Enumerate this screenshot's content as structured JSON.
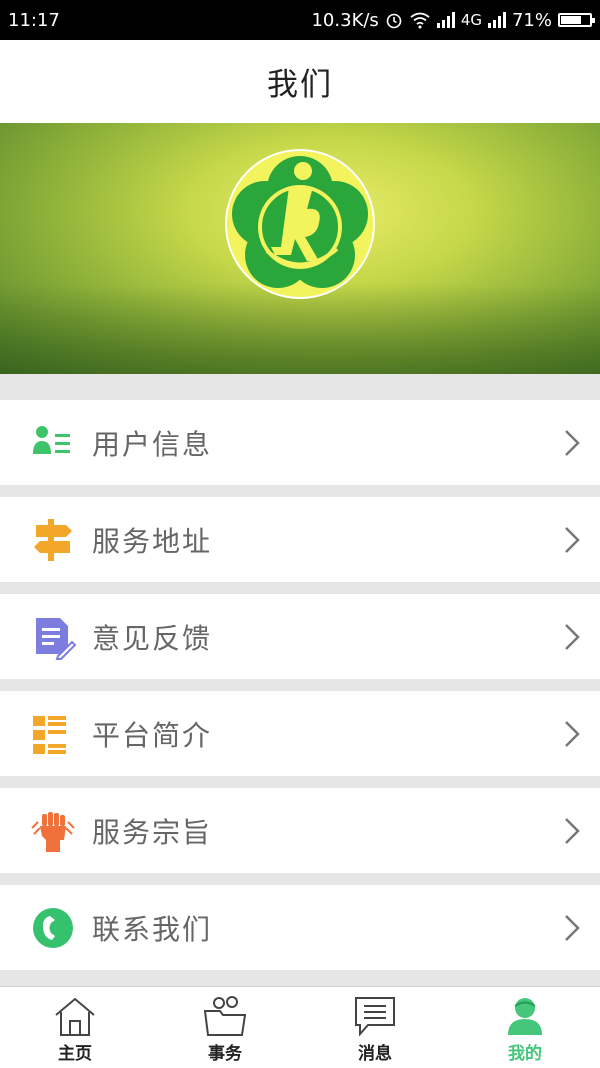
{
  "status_bar": {
    "time": "11:17",
    "network_speed": "10.3K/s",
    "network_type": "4G",
    "battery_percent": "71%",
    "battery_level": 0.71
  },
  "header": {
    "title": "我们"
  },
  "menu": [
    {
      "label": "用户信息",
      "icon": "user-info-icon",
      "color": "#3ec36a"
    },
    {
      "label": "服务地址",
      "icon": "signpost-icon",
      "color": "#f2a62a"
    },
    {
      "label": "意见反馈",
      "icon": "feedback-edit-icon",
      "color": "#7d7ddf"
    },
    {
      "label": "平台简介",
      "icon": "grid-list-icon",
      "color": "#f2a62a"
    },
    {
      "label": "服务宗旨",
      "icon": "fist-icon",
      "color": "#f0713c"
    },
    {
      "label": "联系我们",
      "icon": "phone-circle-icon",
      "color": "#35c16d"
    }
  ],
  "tabs": [
    {
      "label": "主页",
      "icon": "home-icon",
      "active": false
    },
    {
      "label": "事务",
      "icon": "folder-people-icon",
      "active": false
    },
    {
      "label": "消息",
      "icon": "message-icon",
      "active": false
    },
    {
      "label": "我的",
      "icon": "profile-icon",
      "active": true
    }
  ],
  "colors": {
    "accent": "#44c77a",
    "status_bar_bg": "#000000",
    "separator": "#e6e6e6"
  }
}
